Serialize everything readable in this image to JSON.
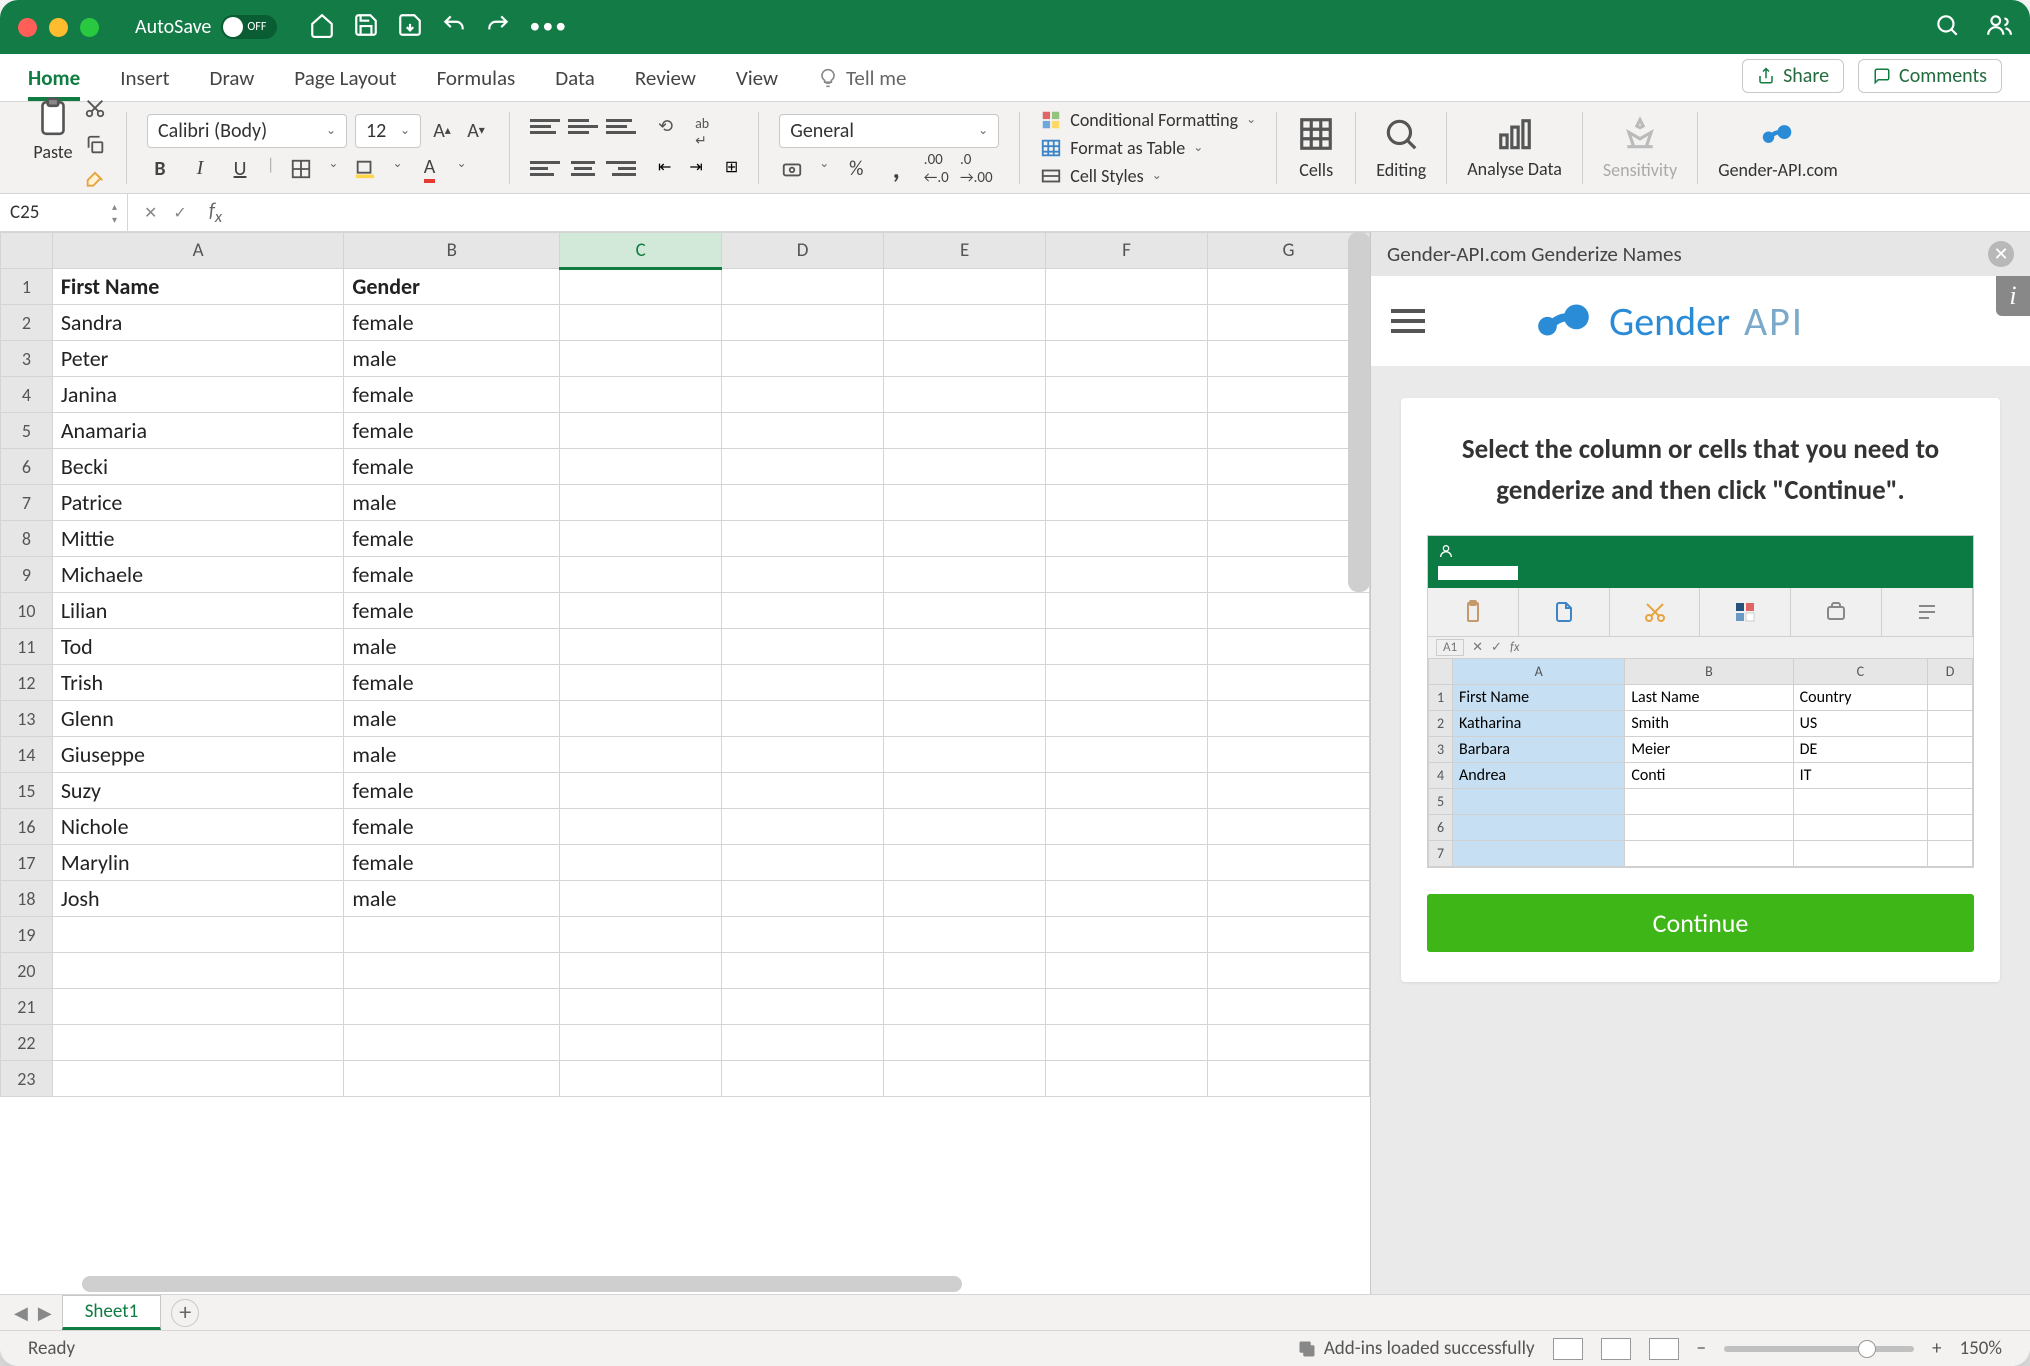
{
  "titlebar": {
    "autosave": "AutoSave",
    "toggle": "OFF"
  },
  "tabs": [
    "Home",
    "Insert",
    "Draw",
    "Page Layout",
    "Formulas",
    "Data",
    "Review",
    "View"
  ],
  "tellme": "Tell me",
  "share": "Share",
  "comments": "Comments",
  "ribbon": {
    "paste": "Paste",
    "font_name": "Calibri (Body)",
    "font_size": "12",
    "number_format": "General",
    "cond_fmt": "Conditional Formatting",
    "fmt_table": "Format as Table",
    "cell_styles": "Cell Styles",
    "cells": "Cells",
    "editing": "Editing",
    "analyse": "Analyse Data",
    "sensitivity": "Sensitivity",
    "genderapi": "Gender-API.com"
  },
  "namebox": "C25",
  "columns": [
    "A",
    "B",
    "C",
    "D",
    "E",
    "F",
    "G"
  ],
  "headers": {
    "a": "First Name",
    "b": "Gender"
  },
  "rows": [
    {
      "n": "1",
      "a": "First Name",
      "b": "Gender",
      "bold": true
    },
    {
      "n": "2",
      "a": "Sandra",
      "b": "female"
    },
    {
      "n": "3",
      "a": "Peter",
      "b": "male"
    },
    {
      "n": "4",
      "a": "Janina",
      "b": "female"
    },
    {
      "n": "5",
      "a": "Anamaria",
      "b": "female"
    },
    {
      "n": "6",
      "a": "Becki",
      "b": "female"
    },
    {
      "n": "7",
      "a": "Patrice",
      "b": "male"
    },
    {
      "n": "8",
      "a": "Mittie",
      "b": "female"
    },
    {
      "n": "9",
      "a": "Michaele",
      "b": "female"
    },
    {
      "n": "10",
      "a": "Lilian",
      "b": "female"
    },
    {
      "n": "11",
      "a": "Tod",
      "b": "male"
    },
    {
      "n": "12",
      "a": "Trish",
      "b": "female"
    },
    {
      "n": "13",
      "a": "Glenn",
      "b": "male"
    },
    {
      "n": "14",
      "a": "Giuseppe",
      "b": "male"
    },
    {
      "n": "15",
      "a": "Suzy",
      "b": "female"
    },
    {
      "n": "16",
      "a": "Nichole",
      "b": "female"
    },
    {
      "n": "17",
      "a": "Marylin",
      "b": "female"
    },
    {
      "n": "18",
      "a": "Josh",
      "b": "male"
    },
    {
      "n": "19",
      "a": "",
      "b": ""
    },
    {
      "n": "20",
      "a": "",
      "b": ""
    },
    {
      "n": "21",
      "a": "",
      "b": ""
    },
    {
      "n": "22",
      "a": "",
      "b": ""
    },
    {
      "n": "23",
      "a": "",
      "b": ""
    }
  ],
  "sheet": "Sheet1",
  "status": {
    "ready": "Ready",
    "addins": "Add-ins loaded successfully",
    "zoom": "150%"
  },
  "taskpane": {
    "title": "Gender-API.com Genderize Names",
    "brand1": "Gender",
    "brand2": "API",
    "instruction": "Select the column or cells that you need to genderize and then click \"Continue\".",
    "demo_nb": "A1",
    "demo_cols": [
      "A",
      "B",
      "C",
      "D"
    ],
    "demo_headers": [
      "First Name",
      "Last Name",
      "Country"
    ],
    "demo_rows": [
      {
        "n": "1",
        "a": "First Name",
        "b": "Last Name",
        "c": "Country"
      },
      {
        "n": "2",
        "a": "Katharina",
        "b": "Smith",
        "c": "US"
      },
      {
        "n": "3",
        "a": "Barbara",
        "b": "Meier",
        "c": "DE"
      },
      {
        "n": "4",
        "a": "Andrea",
        "b": "Conti",
        "c": "IT"
      },
      {
        "n": "5",
        "a": "",
        "b": "",
        "c": ""
      },
      {
        "n": "6",
        "a": "",
        "b": "",
        "c": ""
      },
      {
        "n": "7",
        "a": "",
        "b": "",
        "c": ""
      }
    ],
    "continue": "Continue"
  }
}
